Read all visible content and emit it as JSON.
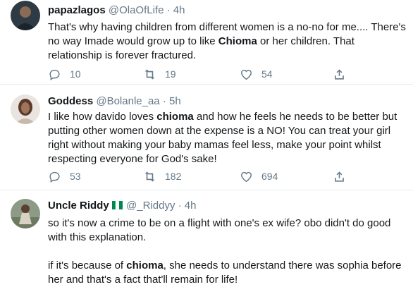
{
  "tweets": [
    {
      "name": "papazlagos",
      "handle": "@OlaOfLife",
      "separator": "·",
      "time": "4h",
      "text": [
        [
          "That's why having children from different women is a no-no for me.... There's no way Imade would grow up to like ",
          "Chioma",
          " or her children. That relationship is forever fractured."
        ]
      ],
      "replies": "10",
      "retweets": "19",
      "likes": "54"
    },
    {
      "name": "Goddess",
      "handle": "@Bolanle_aa",
      "separator": "·",
      "time": "5h",
      "text": [
        [
          "I like how davido loves ",
          "chioma",
          " and how he feels he needs to be better but putting other women down at the expense is a NO! You can treat your girl right without making your baby mamas feel less, make your point whilst respecting everyone for God's sake!"
        ]
      ],
      "replies": "53",
      "retweets": "182",
      "likes": "694"
    },
    {
      "name": "Uncle Riddy",
      "handle": "@_Riddyy",
      "separator": "·",
      "time": "4h",
      "text": [
        [
          "so it's now a crime to be on a flight with one's ex wife? obo didn't do good with this explanation.",
          "",
          ""
        ],
        [
          "if it's because of ",
          "chioma",
          ", she needs to understand there was sophia before her and that's a fact that'll remain for life!"
        ]
      ]
    }
  ],
  "colors": {
    "text": "#14171a",
    "secondary": "#657786",
    "divider": "#e6ecf0",
    "flag_green": "#008751"
  },
  "icons": {
    "reply": "reply-icon",
    "retweet": "retweet-icon",
    "like": "heart-icon",
    "share": "share-icon"
  }
}
